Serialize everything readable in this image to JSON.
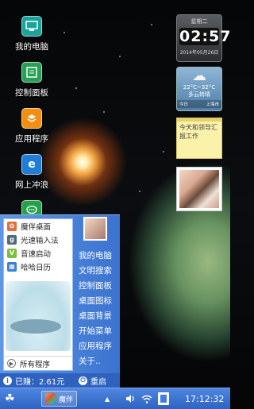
{
  "desktop": {
    "icons": [
      {
        "label": "我的电脑",
        "icon": "computer-icon",
        "color": "#19a39a"
      },
      {
        "label": "控制面板",
        "icon": "control-panel-icon",
        "color": "#25a055"
      },
      {
        "label": "应用程序",
        "icon": "applications-icon",
        "color": "#f08f12"
      },
      {
        "label": "网上冲浪",
        "icon": "internet-explorer-icon",
        "color": "#1f7dd6"
      },
      {
        "label": "",
        "icon": "message-icon",
        "color": "#27a04a"
      }
    ]
  },
  "widgets": {
    "clock": {
      "day": "星期二",
      "time": "02:57",
      "date": "2014年05月26日"
    },
    "weather": {
      "temperature": "22°C~32°C",
      "condition": "多云转晴",
      "day_label": "今日",
      "city": "上海市",
      "icon": "partly-cloudy-icon"
    },
    "note": {
      "text": "今天和领导汇报工作"
    },
    "photo": {
      "icon": "photo-icon"
    }
  },
  "start_menu": {
    "left_items": [
      {
        "label": "魔伴桌面",
        "icon": "mobo-desktop-icon",
        "color": "#e26f3c"
      },
      {
        "label": "光速输入法",
        "icon": "input-method-icon",
        "color": "#546a7a"
      },
      {
        "label": "音速启动",
        "icon": "quick-launch-icon",
        "color": "#7abe3a"
      },
      {
        "label": "哈哈日历",
        "icon": "calendar-icon",
        "color": "#3a7fd6"
      }
    ],
    "all_programs": "所有程序",
    "right_items": [
      "我的电脑",
      "文明搜索",
      "控制面板",
      "桌面图标",
      "桌面背景",
      "开始菜单",
      "应用程序",
      "关于.."
    ],
    "earned": "已赚：2.61元",
    "restart": "重启"
  },
  "taskbar": {
    "start_icon": "clover-start-icon",
    "task_label": "魔伴",
    "time": "17:12:32"
  },
  "colors": {
    "taskbar": "#2d63c2",
    "menu": "#4a82da",
    "note": "#fbf2a9"
  }
}
